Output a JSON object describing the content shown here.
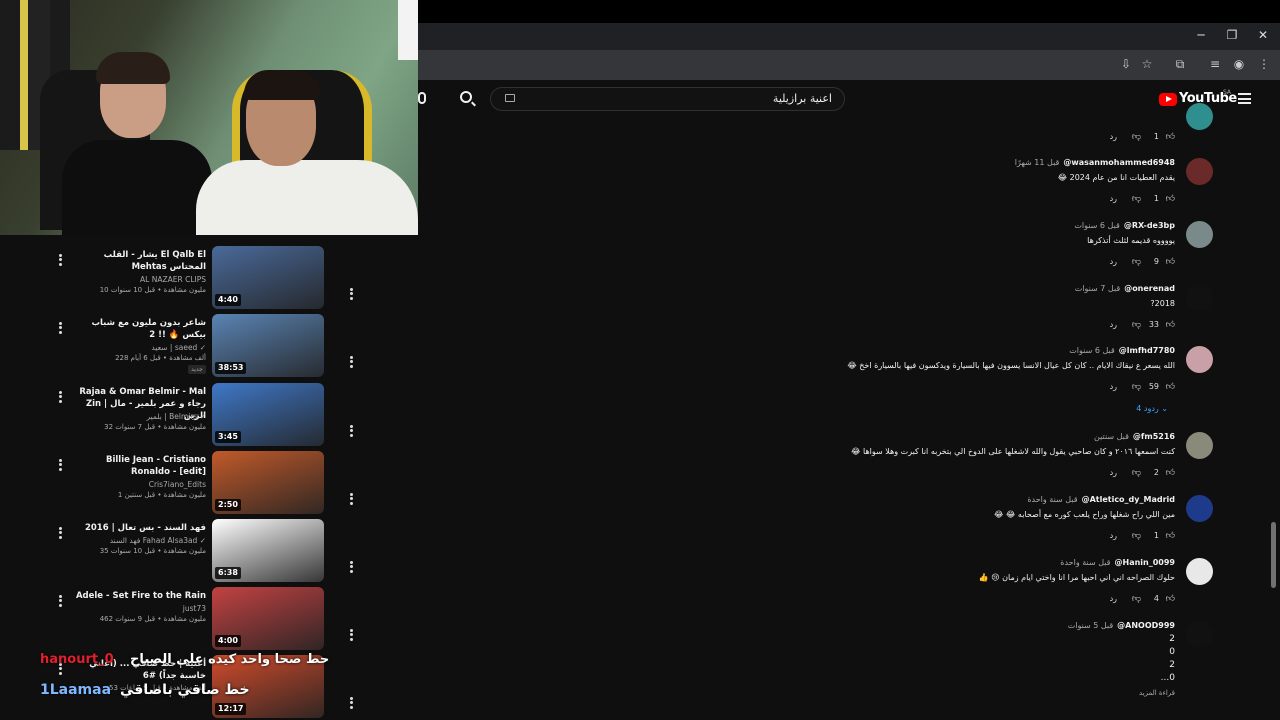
{
  "window": {
    "minimize": "─",
    "restore": "❐",
    "close": "✕"
  },
  "youtube": {
    "logo_text": "YouTube",
    "region": "SA",
    "search_value": "اعنية برازيلية"
  },
  "overlay": {
    "line1_user": "hanourt_0",
    "line1_text": "حط صحا واحد كيده على الصباح",
    "line2_user": "1Laamaa",
    "line2_text": "خط صاقي باصاقي"
  },
  "sidebar": {
    "videos": [
      {
        "title": "يشار - القلب El Qalb El Mehtas المحتاس",
        "channel": "AL NAZAER CLIPS",
        "meta": "10 مليون مشاهدة • قبل 10 سنوات",
        "duration": "4:40",
        "thumb_color": "#4a6a9a"
      },
      {
        "title": "شاعر بدون مليون مع شباب بيكس 🔥 !! 2",
        "channel": "سعيد | saeed ✓",
        "meta": "228 ألف مشاهدة • قبل 6 أيام",
        "badge": "جديد",
        "duration": "38:53",
        "thumb_color": "#5a84b4"
      },
      {
        "title": "Rajaa & Omar Belmir - Mal Zin | رجاء و عمر بلمير - مال الزين",
        "channel": "بلمير | Belmirs ✓",
        "meta": "32 مليون مشاهدة • قبل 7 سنوات",
        "duration": "3:45",
        "thumb_color": "#3f78c8"
      },
      {
        "title": "Billie Jean - Cristiano Ronaldo - [edit]",
        "channel": "Cris7iano_Edits",
        "meta": "1 مليون مشاهدة • قبل سنتين",
        "duration": "2:50",
        "thumb_color": "#c25a2a"
      },
      {
        "title": "فهد السند - بس تعال | 2016",
        "channel": "فهد السند Fahad Alsa3ad ✓",
        "meta": "35 مليون مشاهدة • قبل 10 سنوات",
        "duration": "6:38",
        "thumb_color": "#ffffff"
      },
      {
        "title": "Adele - Set Fire to the Rain",
        "channel": "just73",
        "meta": "462 مليون مشاهدة • قبل 9 سنوات",
        "duration": "4:00",
        "thumb_color": "#c34242"
      },
      {
        "title": "أغنيه | حظ صاقي ... (اغاني خاسبة جداً) #6",
        "channel": "",
        "meta": "53 ألف مشاهدة • قبل 9 ساعات",
        "duration": "12:17",
        "thumb_color": "#d14b2b"
      }
    ]
  },
  "comments": {
    "top_partial": {
      "likes": "1",
      "reply": "رد"
    },
    "items": [
      {
        "author": "@wasanmohammed6948",
        "time": "قبل 11 شهرًا",
        "text": "يقدم العطيات انا من عام 2024 😂",
        "likes": "1",
        "reply": "رد",
        "avatar_color": "#6b2a2a"
      },
      {
        "author": "@RX-de3bp",
        "time": "قبل 6 سنوات",
        "text": "يووووه قديمه لثلث أتذكرها",
        "likes": "9",
        "reply": "رد",
        "avatar_color": "#7a8a8a"
      },
      {
        "author": "@onerenad",
        "time": "قبل 7 سنوات",
        "text": "2018?",
        "likes": "33",
        "reply": "رد",
        "avatar_color": "#111111"
      },
      {
        "author": "@lmfhd7780",
        "time": "قبل 6 سنوات",
        "text": "الله يسعر ع نيقاك الايام .. كان كل عيال الانسا يسوون فيها بالسيارة ويدكسون فيها بالسيارة اخخ 😂",
        "likes": "59",
        "reply": "رد",
        "replies": "4 ردود",
        "avatar_color": "#c9a0a8"
      },
      {
        "author": "@fm5216",
        "time": "قبل سنتين",
        "text": "كنت اسمعها ٢٠١٦ و كان صاحبي يقول والله لاشغلها على الدوخ الي بتخربه انا كبرت وهلا سواها 😂",
        "likes": "2",
        "reply": "رد",
        "avatar_color": "#8a8a7a"
      },
      {
        "author": "@Atletico_dy_Madrid",
        "time": "قبل سنة واحدة",
        "text": "مين اللي راح شغلها وراح يلعب كوره مع أصحابه 😂 😂",
        "likes": "1",
        "reply": "رد",
        "avatar_color": "#1e3a8a"
      },
      {
        "author": "@Hanin_0099",
        "time": "قبل سنة واحدة",
        "text": "حلوك الصراحه اني اني احبها مرا انا واختي ايام زمان 😢 👍",
        "likes": "4",
        "reply": "رد",
        "avatar_color": "#e8e8e8"
      },
      {
        "author": "@ANOOD999",
        "time": "قبل 5 سنوات",
        "text_lines": [
          "2",
          "0",
          "2",
          "0..."
        ],
        "read_more": "قراءة المزيد",
        "avatar_color": "#111111"
      }
    ]
  },
  "colors": {
    "bg": "#0f0f0f",
    "accent": "#ff0000",
    "link": "#3ea6ff"
  }
}
